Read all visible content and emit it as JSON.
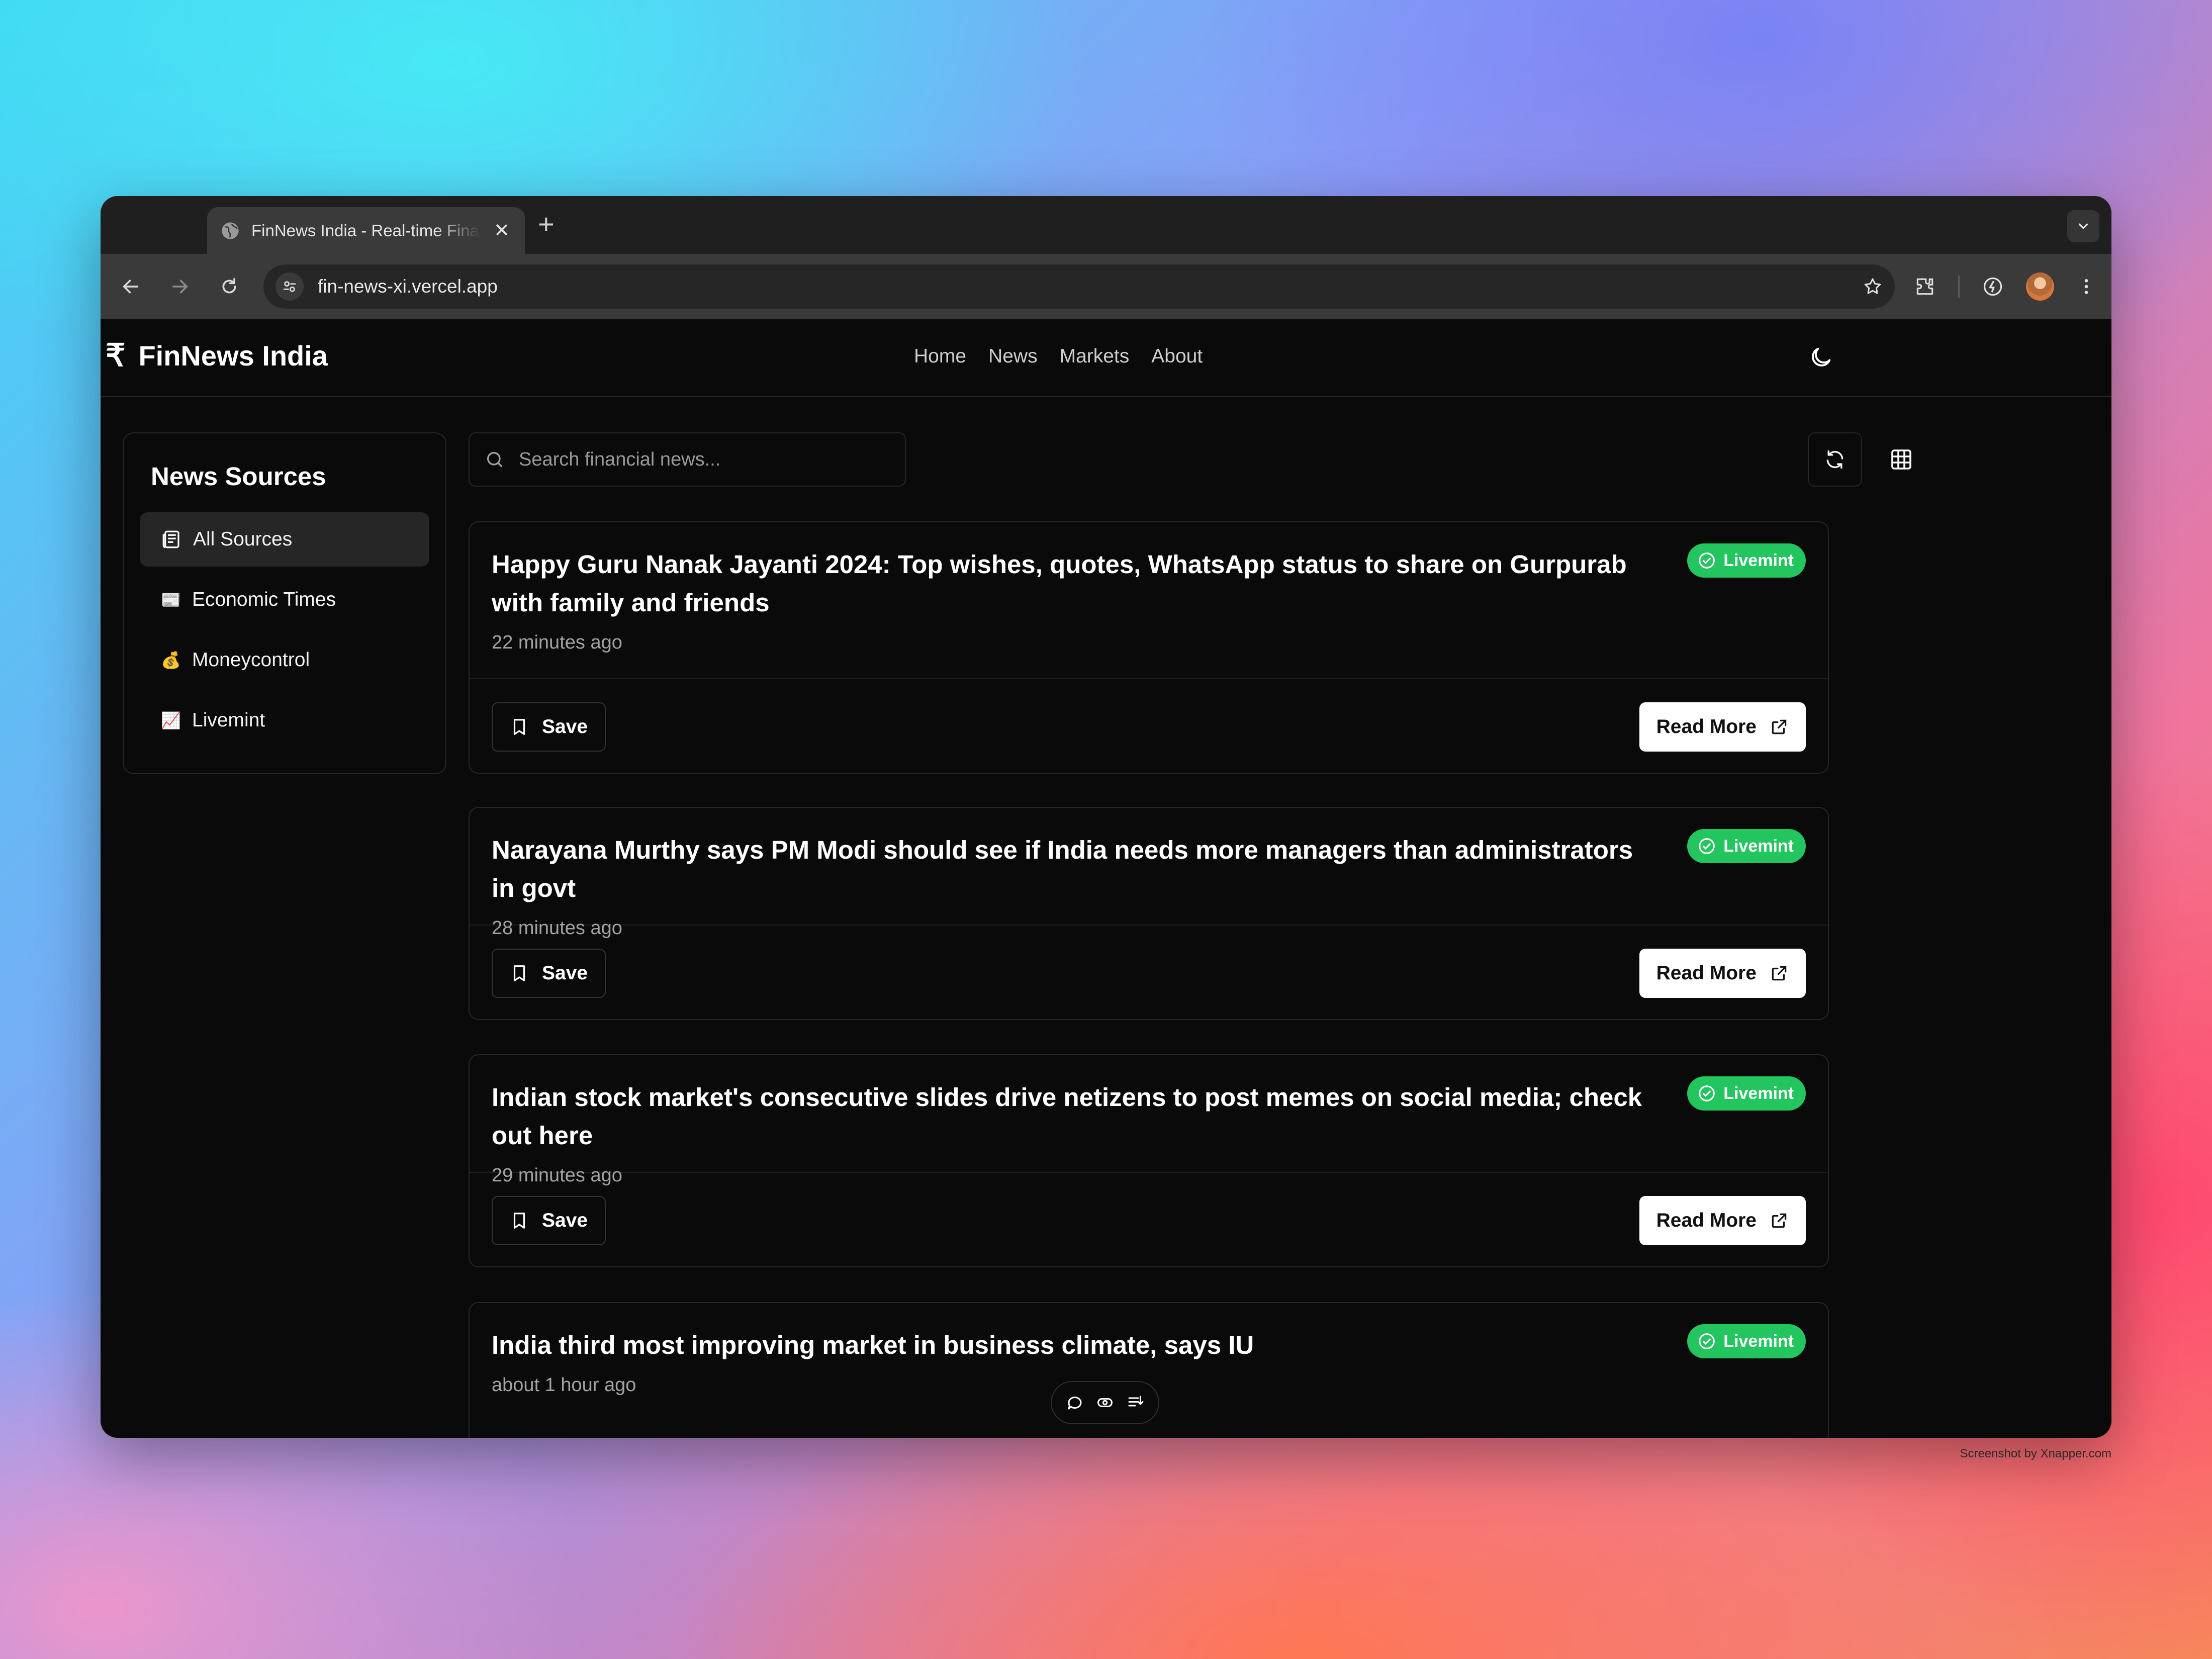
{
  "browser": {
    "tab_title": "FinNews India - Real-time Financial News",
    "url": "fin-news-xi.vercel.app",
    "new_tab_symbol": "+",
    "close_symbol": "✕"
  },
  "header": {
    "brand_symbol": "₹",
    "brand_name": "FinNews India",
    "nav": [
      "Home",
      "News",
      "Markets",
      "About"
    ]
  },
  "sidebar": {
    "title": "News Sources",
    "items": [
      {
        "label": "All Sources",
        "icon": "newspaper-icon",
        "emoji": "",
        "active": true
      },
      {
        "label": "Economic Times",
        "icon": "newspaper-emoji",
        "emoji": "📰",
        "active": false
      },
      {
        "label": "Moneycontrol",
        "icon": "money-bag-emoji",
        "emoji": "💰",
        "active": false
      },
      {
        "label": "Livemint",
        "icon": "chart-emoji",
        "emoji": "📈",
        "active": false
      }
    ]
  },
  "search": {
    "placeholder": "Search financial news..."
  },
  "articles": [
    {
      "title": "Happy Guru Nanak Jayanti 2024: Top wishes, quotes, WhatsApp status to share on Gurpurab with family and friends",
      "time": "22 minutes ago",
      "source": "Livemint",
      "save_label": "Save",
      "read_label": "Read More"
    },
    {
      "title": "Narayana Murthy says PM Modi should see if India needs more managers than administrators in govt",
      "time": "28 minutes ago",
      "source": "Livemint",
      "save_label": "Save",
      "read_label": "Read More"
    },
    {
      "title": "Indian stock market's consecutive slides drive netizens to post memes on social media; check out here",
      "time": "29 minutes ago",
      "source": "Livemint",
      "save_label": "Save",
      "read_label": "Read More"
    },
    {
      "title": "India third most improving market in business climate, says IU",
      "time": "about 1 hour ago",
      "source": "Livemint"
    }
  ],
  "colors": {
    "badge": "#22c55e",
    "background": "#0a0a0a",
    "border": "#262626"
  },
  "credit": "Screenshot by Xnapper.com"
}
